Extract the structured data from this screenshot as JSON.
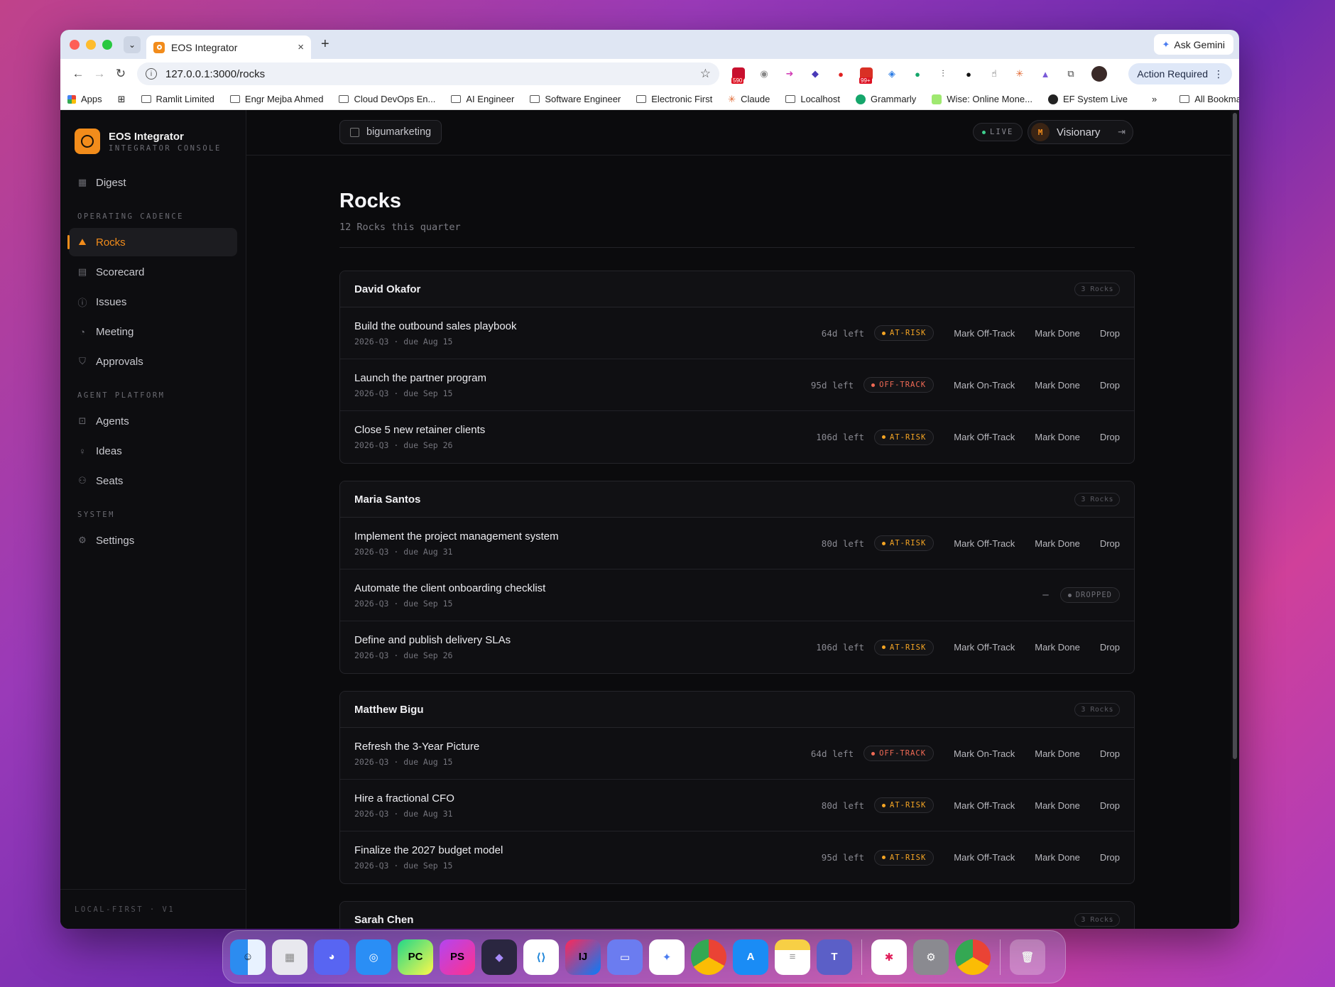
{
  "browser": {
    "tab_title": "EOS Integrator",
    "tab_close": "×",
    "new_tab": "+",
    "gemini_label": "Ask Gemini",
    "url": "127.0.0.1:3000/rocks",
    "action_required": "Action Required",
    "extension_badges": [
      "590",
      "99+"
    ],
    "bookmarks": [
      {
        "label": "Apps",
        "icon": "apps-grid-icon"
      },
      {
        "label": "",
        "icon": "tab-groups-icon"
      },
      {
        "label": "Ramlit Limited",
        "icon": "folder-icon"
      },
      {
        "label": "Engr Mejba Ahmed",
        "icon": "folder-icon"
      },
      {
        "label": "Cloud DevOps En...",
        "icon": "folder-icon"
      },
      {
        "label": "AI Engineer",
        "icon": "folder-icon"
      },
      {
        "label": "Software Engineer",
        "icon": "folder-icon"
      },
      {
        "label": "Electronic First",
        "icon": "folder-icon"
      },
      {
        "label": "Claude",
        "icon": "claude-icon"
      },
      {
        "label": "Localhost",
        "icon": "folder-icon"
      },
      {
        "label": "Grammarly",
        "icon": "grammarly-icon"
      },
      {
        "label": "Wise: Online Mone...",
        "icon": "wise-icon"
      },
      {
        "label": "EF System Live",
        "icon": "ef-icon"
      }
    ],
    "bookmarks_overflow": "»",
    "all_bookmarks": "All Bookmarks"
  },
  "sidebar": {
    "brand_title": "EOS Integrator",
    "brand_subtitle": "INTEGRATOR CONSOLE",
    "top_items": [
      {
        "label": "Digest",
        "icon": "grid-icon"
      }
    ],
    "sections": [
      {
        "title": "OPERATING CADENCE",
        "items": [
          {
            "label": "Rocks",
            "icon": "mountain-icon",
            "active": true
          },
          {
            "label": "Scorecard",
            "icon": "table-icon"
          },
          {
            "label": "Issues",
            "icon": "alert-circle-icon"
          },
          {
            "label": "Meeting",
            "icon": "timer-icon"
          },
          {
            "label": "Approvals",
            "icon": "shield-check-icon"
          }
        ]
      },
      {
        "title": "AGENT PLATFORM",
        "items": [
          {
            "label": "Agents",
            "icon": "robot-icon"
          },
          {
            "label": "Ideas",
            "icon": "lightbulb-icon"
          },
          {
            "label": "Seats",
            "icon": "users-icon"
          }
        ]
      },
      {
        "title": "SYSTEM",
        "items": [
          {
            "label": "Settings",
            "icon": "gear-icon"
          }
        ]
      }
    ],
    "footer": "LOCAL-FIRST · V1"
  },
  "topbar": {
    "workspace": "bigumarketing",
    "live": "LIVE",
    "user_initial": "M",
    "user_role": "Visionary"
  },
  "page": {
    "title": "Rocks",
    "subtitle": "12 Rocks this quarter"
  },
  "groups": [
    {
      "owner": "David Okafor",
      "count": "3 Rocks",
      "rocks": [
        {
          "title": "Build the outbound sales playbook",
          "meta": "2026-Q3 · due Aug 15",
          "days": "64d left",
          "status": "AT-RISK",
          "status_kind": "at-risk",
          "actions": [
            "Mark Off-Track",
            "Mark Done",
            "Drop"
          ]
        },
        {
          "title": "Launch the partner program",
          "meta": "2026-Q3 · due Sep 15",
          "days": "95d left",
          "status": "OFF-TRACK",
          "status_kind": "off-track",
          "actions": [
            "Mark On-Track",
            "Mark Done",
            "Drop"
          ]
        },
        {
          "title": "Close 5 new retainer clients",
          "meta": "2026-Q3 · due Sep 26",
          "days": "106d left",
          "status": "AT-RISK",
          "status_kind": "at-risk",
          "actions": [
            "Mark Off-Track",
            "Mark Done",
            "Drop"
          ]
        }
      ]
    },
    {
      "owner": "Maria Santos",
      "count": "3 Rocks",
      "rocks": [
        {
          "title": "Implement the project management system",
          "meta": "2026-Q3 · due Aug 31",
          "days": "80d left",
          "status": "AT-RISK",
          "status_kind": "at-risk",
          "actions": [
            "Mark Off-Track",
            "Mark Done",
            "Drop"
          ]
        },
        {
          "title": "Automate the client onboarding checklist",
          "meta": "2026-Q3 · due Sep 15",
          "days": "—",
          "status": "DROPPED",
          "status_kind": "dropped",
          "actions": []
        },
        {
          "title": "Define and publish delivery SLAs",
          "meta": "2026-Q3 · due Sep 26",
          "days": "106d left",
          "status": "AT-RISK",
          "status_kind": "at-risk",
          "actions": [
            "Mark Off-Track",
            "Mark Done",
            "Drop"
          ]
        }
      ]
    },
    {
      "owner": "Matthew Bigu",
      "count": "3 Rocks",
      "rocks": [
        {
          "title": "Refresh the 3-Year Picture",
          "meta": "2026-Q3 · due Aug 15",
          "days": "64d left",
          "status": "OFF-TRACK",
          "status_kind": "off-track",
          "actions": [
            "Mark On-Track",
            "Mark Done",
            "Drop"
          ]
        },
        {
          "title": "Hire a fractional CFO",
          "meta": "2026-Q3 · due Aug 31",
          "days": "80d left",
          "status": "AT-RISK",
          "status_kind": "at-risk",
          "actions": [
            "Mark Off-Track",
            "Mark Done",
            "Drop"
          ]
        },
        {
          "title": "Finalize the 2027 budget model",
          "meta": "2026-Q3 · due Sep 15",
          "days": "95d left",
          "status": "AT-RISK",
          "status_kind": "at-risk",
          "actions": [
            "Mark Off-Track",
            "Mark Done",
            "Drop"
          ]
        }
      ]
    },
    {
      "owner": "Sarah Chen",
      "count": "3 Rocks",
      "rocks": []
    }
  ],
  "colors": {
    "accent": "#f28c1b",
    "at_risk": "#f5a524",
    "off_track": "#f06a55",
    "live": "#3ecf8e",
    "background": "#0b0b0d"
  },
  "dock": [
    "finder",
    "launchpad",
    "discord",
    "safari",
    "pycharm",
    "phpstorm",
    "obsidian",
    "vscode",
    "intellij",
    "terminal-app",
    "gemini",
    "chrome",
    "app-store",
    "notes",
    "teams",
    "slack",
    "system-settings",
    "chrome-profile",
    "trash"
  ]
}
